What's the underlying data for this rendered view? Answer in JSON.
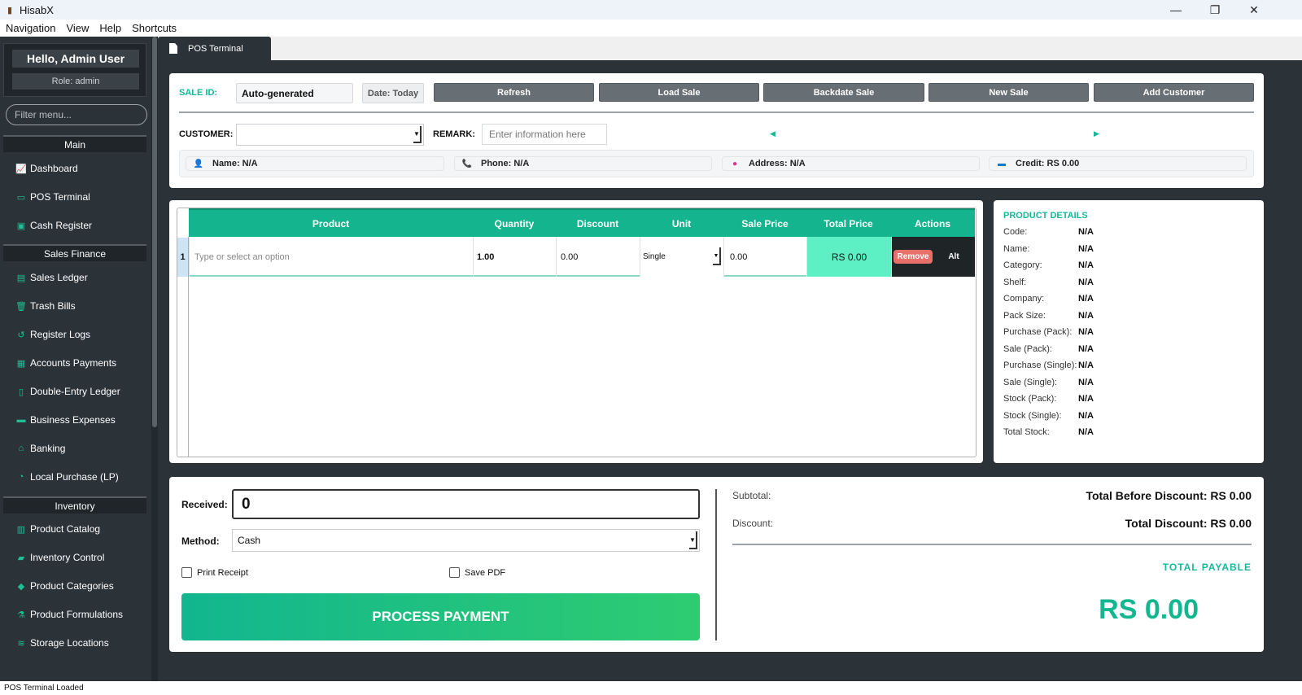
{
  "window": {
    "title": "HisabX",
    "minimize": "—",
    "maximize": "❐",
    "close": "✕"
  },
  "menu": [
    "Navigation",
    "View",
    "Help",
    "Shortcuts"
  ],
  "sidebar": {
    "greeting": "Hello, Admin User",
    "role": "Role: admin",
    "filter_placeholder": "Filter menu...",
    "sections": [
      {
        "title": "Main",
        "items": [
          {
            "label": "Dashboard",
            "icon": "chart-icon"
          },
          {
            "label": "POS Terminal",
            "icon": "monitor-icon"
          },
          {
            "label": "Cash Register",
            "icon": "register-icon"
          }
        ]
      },
      {
        "title": "Sales  Finance",
        "items": [
          {
            "label": "Sales Ledger",
            "icon": "ledger-icon"
          },
          {
            "label": "Trash Bills",
            "icon": "trash-icon"
          },
          {
            "label": "Register Logs",
            "icon": "history-icon"
          },
          {
            "label": "Accounts  Payments",
            "icon": "invoice-icon"
          },
          {
            "label": "Double-Entry Ledger",
            "icon": "document-icon"
          },
          {
            "label": "Business Expenses",
            "icon": "money-icon"
          },
          {
            "label": "Banking",
            "icon": "bank-icon"
          },
          {
            "label": "Local Purchase (LP)",
            "icon": "pie-icon"
          }
        ]
      },
      {
        "title": "Inventory",
        "items": [
          {
            "label": "Product Catalog",
            "icon": "boxes-icon"
          },
          {
            "label": "Inventory Control",
            "icon": "truck-icon"
          },
          {
            "label": "Product Categories",
            "icon": "tags-icon"
          },
          {
            "label": "Product Formulations",
            "icon": "flask-icon"
          },
          {
            "label": "Storage Locations",
            "icon": "layers-icon"
          }
        ]
      }
    ]
  },
  "tab": {
    "label": "POS Terminal"
  },
  "sale": {
    "sale_id_label": "SALE ID:",
    "sale_id_value": "Auto-generated",
    "date_label": "Date: Today",
    "buttons": [
      "Refresh",
      "Load Sale",
      "Backdate Sale",
      "New Sale",
      "Add Customer"
    ],
    "customer_label": "CUSTOMER:",
    "customer_value": "",
    "remark_label": "REMARK:",
    "remark_placeholder": "Enter information here",
    "info": {
      "name": "Name: N/A",
      "phone": "Phone: N/A",
      "address": "Address: N/A",
      "credit": "Credit: RS 0.00"
    }
  },
  "cart": {
    "columns": [
      "Product",
      "Quantity",
      "Discount",
      "Unit",
      "Sale Price",
      "Total Price",
      "Actions"
    ],
    "rows": [
      {
        "num": "1",
        "product_placeholder": "Type or select an option",
        "quantity": "1.00",
        "discount": "0.00",
        "unit": "Single",
        "sale_price": "0.00",
        "total": "RS 0.00",
        "remove": "Remove",
        "alt": "Alt"
      }
    ]
  },
  "product_details": {
    "title": "PRODUCT DETAILS",
    "fields": [
      {
        "label": "Code:",
        "value": "N/A"
      },
      {
        "label": "Name:",
        "value": "N/A"
      },
      {
        "label": "Category:",
        "value": "N/A"
      },
      {
        "label": "Shelf:",
        "value": "N/A"
      },
      {
        "label": "Company:",
        "value": "N/A"
      },
      {
        "label": "Pack Size:",
        "value": "N/A"
      },
      {
        "label": "Purchase (Pack):",
        "value": "N/A"
      },
      {
        "label": "Sale (Pack):",
        "value": "N/A"
      },
      {
        "label": "Purchase (Single):",
        "value": "N/A"
      },
      {
        "label": "Sale (Single):",
        "value": "N/A"
      },
      {
        "label": "Stock (Pack):",
        "value": "N/A"
      },
      {
        "label": "Stock (Single):",
        "value": "N/A"
      },
      {
        "label": "Total Stock:",
        "value": "N/A"
      }
    ]
  },
  "payment": {
    "received_label": "Received:",
    "received_value": "0",
    "method_label": "Method:",
    "method_value": "Cash",
    "print_receipt": "Print Receipt",
    "print_receipt_checked": false,
    "save_pdf": "Save PDF",
    "save_pdf_checked": false,
    "process_button": "PROCESS PAYMENT"
  },
  "totals": {
    "subtotal_label": "Subtotal:",
    "subtotal_value": "Total Before Discount: RS 0.00",
    "discount_label": "Discount:",
    "discount_value": "Total Discount: RS 0.00",
    "payable_label": "TOTAL PAYABLE",
    "payable_value": "RS 0.00"
  },
  "status": "POS Terminal Loaded",
  "colors": {
    "accent": "#14b48e",
    "dark": "#2b3339",
    "button_gray": "#676e74",
    "remove_red": "#e8706b"
  }
}
